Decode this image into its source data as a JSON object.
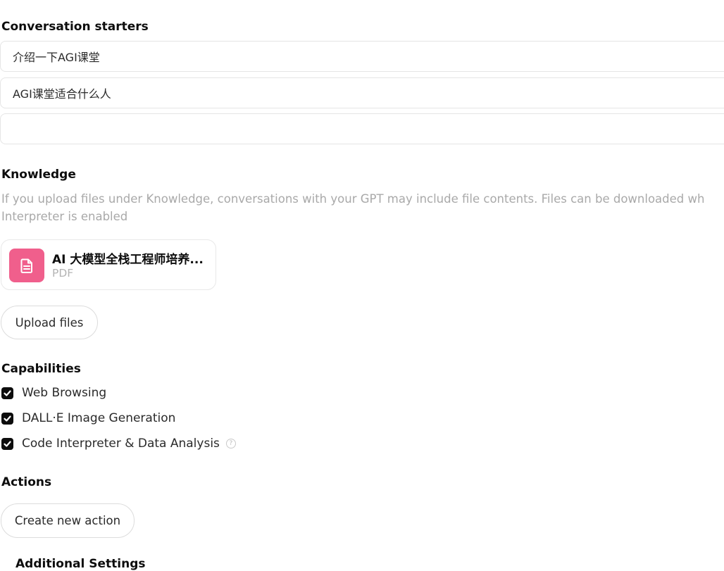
{
  "conversation_starters": {
    "title": "Conversation starters",
    "items": [
      {
        "value": "介绍一下AGI课堂"
      },
      {
        "value": "AGI课堂适合什么人"
      },
      {
        "value": ""
      }
    ]
  },
  "knowledge": {
    "title": "Knowledge",
    "help_line_1": "If you upload files under Knowledge, conversations with your GPT may include file contents. Files can be downloaded wh",
    "help_line_2": "Interpreter is enabled",
    "file": {
      "name": "AI 大模型全栈工程师培养...",
      "type": "PDF",
      "icon": "document-icon",
      "icon_color": "#f05f8c"
    },
    "upload_label": "Upload files"
  },
  "capabilities": {
    "title": "Capabilities",
    "items": [
      {
        "label": "Web Browsing",
        "checked": true
      },
      {
        "label": "DALL·E Image Generation",
        "checked": true
      },
      {
        "label": "Code Interpreter & Data Analysis",
        "checked": true,
        "info_glyph": "?"
      }
    ]
  },
  "actions": {
    "title": "Actions",
    "create_label": "Create new action"
  },
  "additional_settings": {
    "title": "Additional Settings"
  }
}
